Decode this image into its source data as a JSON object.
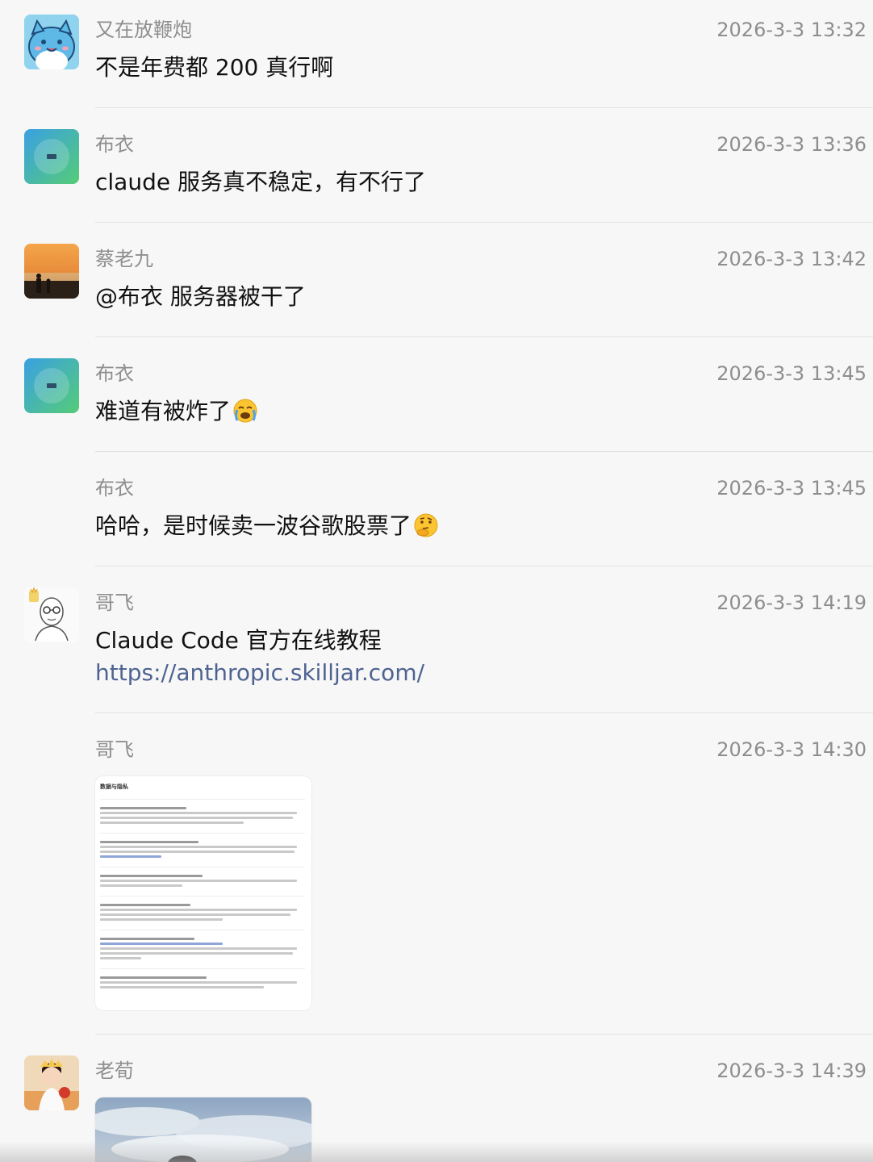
{
  "messages": [
    {
      "name": "又在放鞭炮",
      "time": "2026-3-3 13:32",
      "text": "不是年费都 200 真行啊"
    },
    {
      "name": "布衣",
      "time": "2026-3-3 13:36",
      "text": "claude 服务真不稳定，有不行了"
    },
    {
      "name": "蔡老九",
      "time": "2026-3-3 13:42",
      "text": "@布衣 服务器被干了"
    },
    {
      "name": "布衣",
      "time": "2026-3-3 13:45",
      "text": "难道有被炸了",
      "emoji": "crying-face-icon"
    },
    {
      "name": "布衣",
      "time": "2026-3-3 13:45",
      "text": "哈哈，是时候卖一波谷歌股票了",
      "emoji": "thinking-face-icon"
    },
    {
      "name": "哥飞",
      "time": "2026-3-3 14:19",
      "text": "Claude Code 官方在线教程",
      "link": "https://anthropic.skilljar.com/"
    },
    {
      "name": "哥飞",
      "time": "2026-3-3 14:30",
      "image_title": "数据与隐私"
    },
    {
      "name": "老荀",
      "time": "2026-3-3 14:39"
    }
  ],
  "colors": {
    "link": "#4f6391",
    "meta": "#8e8e8e",
    "text": "#111111",
    "background": "#f7f7f7"
  }
}
